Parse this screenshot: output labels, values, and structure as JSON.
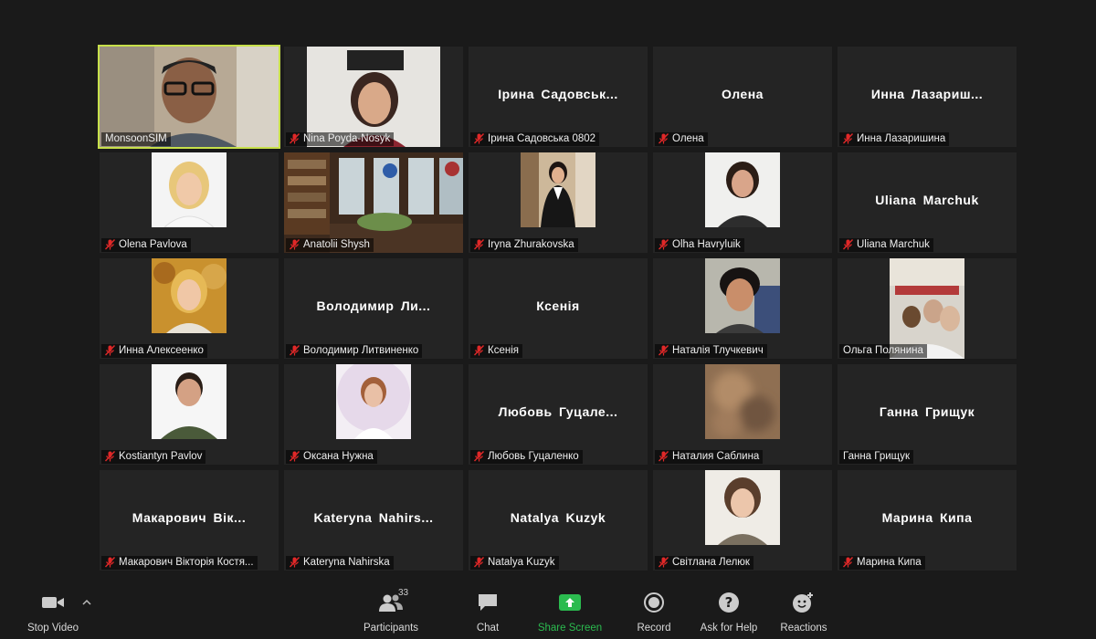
{
  "participants": [
    {
      "display": "",
      "tag": "MonsoonSIM",
      "muted": false,
      "active": true,
      "photo": "photo-man-glasses"
    },
    {
      "display": "",
      "tag": "Nina Poyda-Nosyk",
      "muted": true,
      "photo": "photo-woman-dark-hair"
    },
    {
      "display": "Ірина Садовськ...",
      "tag": "Ірина Садовська 0802",
      "muted": true
    },
    {
      "display": "Олена",
      "tag": "Олена",
      "muted": true
    },
    {
      "display": "Инна Лазариш...",
      "tag": "Инна Лазаришина",
      "muted": true
    },
    {
      "display": "",
      "tag": "Olena Pavlova",
      "muted": true,
      "photo": "photo-woman-blonde"
    },
    {
      "display": "",
      "tag": "Anatolii Shysh",
      "muted": true,
      "photo": "photo-library-room"
    },
    {
      "display": "",
      "tag": "Iryna Zhurakovska",
      "muted": true,
      "photo": "photo-woman-office"
    },
    {
      "display": "",
      "tag": "Olha Havryluik",
      "muted": true,
      "photo": "photo-woman-short-hair"
    },
    {
      "display": "Uliana Marchuk",
      "tag": "Uliana Marchuk",
      "muted": true
    },
    {
      "display": "",
      "tag": "Инна Алексеенко",
      "muted": true,
      "photo": "photo-woman-autumn"
    },
    {
      "display": "Володимир Ли...",
      "tag": "Володимир Литвиненко",
      "muted": true
    },
    {
      "display": "Ксенія",
      "tag": "Ксенія",
      "muted": true
    },
    {
      "display": "",
      "tag": "Наталія Тлучкевич",
      "muted": true,
      "photo": "photo-woman-smiling"
    },
    {
      "display": "",
      "tag": "Ольга Полянина",
      "muted": false,
      "photo": "photo-group-women"
    },
    {
      "display": "",
      "tag": "Kostiantyn Pavlov",
      "muted": true,
      "photo": "photo-man-green-shirt"
    },
    {
      "display": "",
      "tag": "Оксана Нужна",
      "muted": true,
      "photo": "photo-woman-white-frame"
    },
    {
      "display": "Любовь Гуцале...",
      "tag": "Любовь Гуцаленко",
      "muted": true
    },
    {
      "display": "",
      "tag": "Наталия Саблина",
      "muted": true,
      "photo": "photo-blurred"
    },
    {
      "display": "Ганна Грищук",
      "tag": "Ганна Грищук",
      "muted": false
    },
    {
      "display": "Макарович Вік...",
      "tag": "Макарович Вікторія Костя...",
      "muted": true
    },
    {
      "display": "Kateryna Nahirs...",
      "tag": "Kateryna Nahirska",
      "muted": true
    },
    {
      "display": "Natalya Kuzyk",
      "tag": "Natalya Kuzyk",
      "muted": true
    },
    {
      "display": "",
      "tag": "Світлана Лелюк",
      "muted": true,
      "photo": "photo-woman-bob-hair"
    },
    {
      "display": "Марина Кипа",
      "tag": "Марина Кипа",
      "muted": true
    }
  ],
  "toolbar": {
    "stop_video": "Stop Video",
    "participants": "Participants",
    "participants_count": "33",
    "chat": "Chat",
    "share_screen": "Share Screen",
    "record": "Record",
    "ask_for_help": "Ask for Help",
    "reactions": "Reactions"
  },
  "icons": {
    "mic_off": "mic-muted-icon",
    "video": "video-camera-icon",
    "participants": "people-icon",
    "chat": "chat-bubble-icon",
    "share": "share-screen-icon",
    "record": "record-icon",
    "help": "question-icon",
    "reactions": "smiley-plus-icon"
  },
  "colors": {
    "active_speaker": "#c7e04a",
    "share_screen": "#2bbb4f",
    "muted": "#e02828",
    "tile_bg": "#242424",
    "window_bg": "#1a1a1a"
  }
}
